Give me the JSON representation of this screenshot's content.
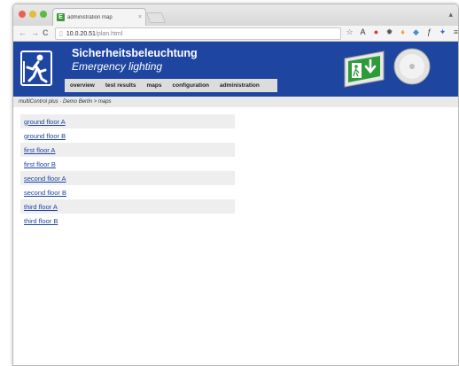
{
  "browser": {
    "tab_title": "administration map",
    "tab_favicon": "E",
    "close_glyph": "×",
    "url_host": "10.0.20.51",
    "url_path": "/plan.html",
    "back_glyph": "←",
    "forward_glyph": "→",
    "reload_glyph": "C",
    "page_glyph": "▯",
    "user_glyph": "▴",
    "extensions": [
      {
        "name": "star-icon",
        "glyph": "☆",
        "color": "#666666"
      },
      {
        "name": "font-icon",
        "glyph": "A",
        "color": "#333333"
      },
      {
        "name": "adblock-icon",
        "glyph": "●",
        "color": "#d9362f"
      },
      {
        "name": "gear-icon",
        "glyph": "✹",
        "color": "#555555"
      },
      {
        "name": "lightbulb-icon",
        "glyph": "♦",
        "color": "#e8a23c"
      },
      {
        "name": "puzzle-icon",
        "glyph": "◆",
        "color": "#3e8fd6"
      },
      {
        "name": "formula-icon",
        "glyph": "ƒ",
        "color": "#444444"
      },
      {
        "name": "bird-icon",
        "glyph": "✦",
        "color": "#3b6fc4"
      },
      {
        "name": "menu-icon",
        "glyph": "≡",
        "color": "#555555"
      }
    ]
  },
  "header": {
    "title": "Sicherheitsbeleuchtung",
    "subtitle": "Emergency lighting",
    "brand_color": "#1e46a0"
  },
  "menu": {
    "items": [
      "overview",
      "test results",
      "maps",
      "configuration",
      "administration"
    ]
  },
  "breadcrumb": "multiControl plus · Demo Berlin > maps",
  "maps": [
    "ground floor A",
    "ground floor B",
    "first floor A",
    "first floor B",
    "second floor A",
    "second floor B",
    "third floor A",
    "third floor B"
  ]
}
